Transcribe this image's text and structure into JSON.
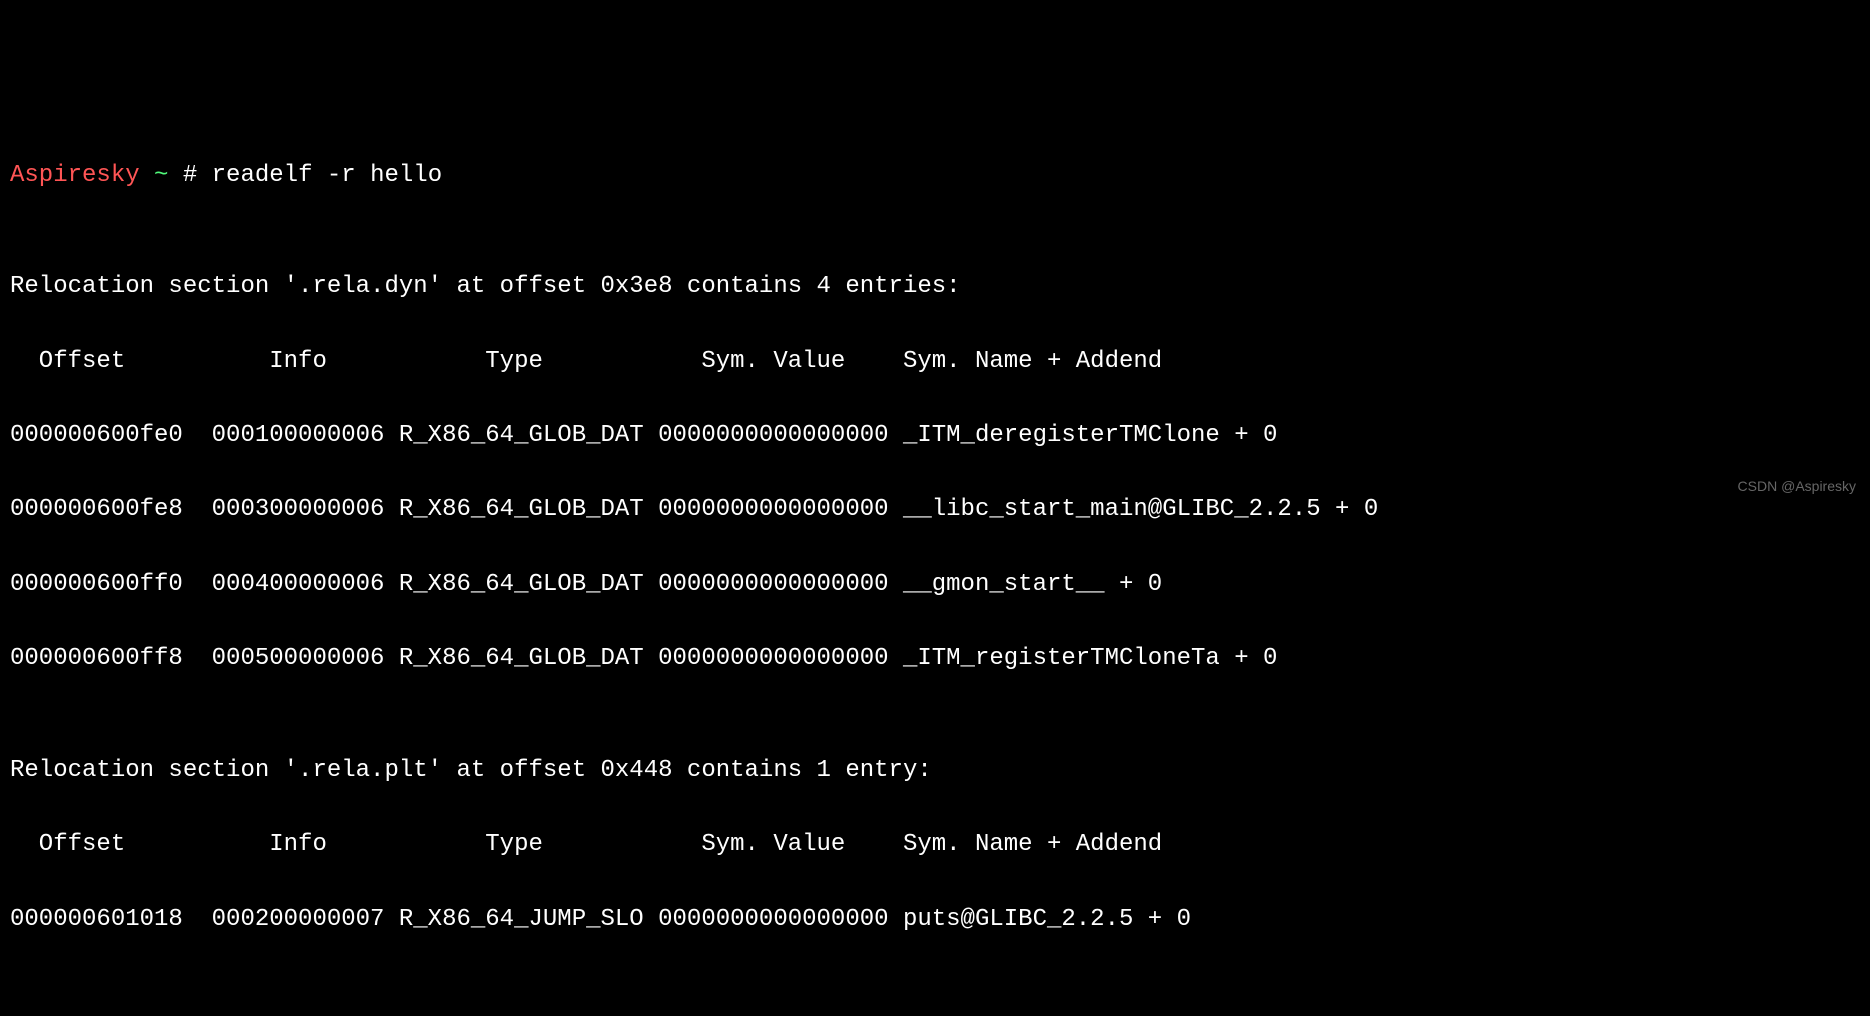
{
  "prompt": {
    "host": "Aspiresky",
    "tilde": " ~ ",
    "hash": "# "
  },
  "command": "readelf -r hello",
  "blank": "",
  "sections": [
    {
      "header": "Relocation section '.rela.dyn' at offset 0x3e8 contains 4 entries:",
      "columns": "  Offset          Info           Type           Sym. Value    Sym. Name + Addend",
      "rows": [
        "000000600fe0  000100000006 R_X86_64_GLOB_DAT 0000000000000000 _ITM_deregisterTMClone + 0",
        "000000600fe8  000300000006 R_X86_64_GLOB_DAT 0000000000000000 __libc_start_main@GLIBC_2.2.5 + 0",
        "000000600ff0  000400000006 R_X86_64_GLOB_DAT 0000000000000000 __gmon_start__ + 0",
        "000000600ff8  000500000006 R_X86_64_GLOB_DAT 0000000000000000 _ITM_registerTMCloneTa + 0"
      ]
    },
    {
      "header": "Relocation section '.rela.plt' at offset 0x448 contains 1 entry:",
      "columns": "  Offset          Info           Type           Sym. Value    Sym. Name + Addend",
      "rows": [
        "000000601018  000200000007 R_X86_64_JUMP_SLO 0000000000000000 puts@GLIBC_2.2.5 + 0"
      ]
    }
  ],
  "watermark": "CSDN @Aspiresky"
}
